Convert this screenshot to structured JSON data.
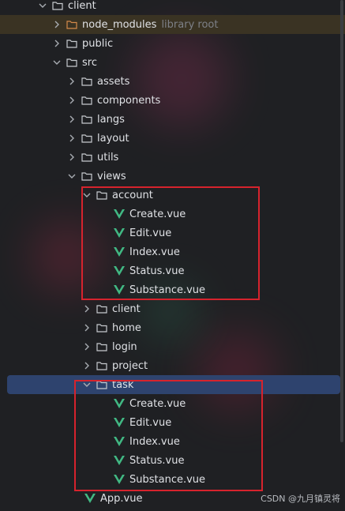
{
  "tree": {
    "root": "client",
    "node_modules": {
      "label": "node_modules",
      "hint": "library root"
    },
    "public": "public",
    "src": "src",
    "src_children": [
      "assets",
      "components",
      "langs",
      "layout",
      "utils"
    ],
    "views": "views",
    "account": {
      "label": "account",
      "files": [
        "Create.vue",
        "Edit.vue",
        "Index.vue",
        "Status.vue",
        "Substance.vue"
      ]
    },
    "views_children": [
      "client",
      "home",
      "login",
      "project"
    ],
    "task": {
      "label": "task",
      "files": [
        "Create.vue",
        "Edit.vue",
        "Index.vue",
        "Status.vue",
        "Substance.vue"
      ]
    },
    "app_file": "App.vue"
  },
  "watermark": "CSDN @九月镇灵将",
  "colors": {
    "background": "#1f2023",
    "selected_row": "#2e436e",
    "highlight": "#d6232d",
    "vue_green": "#41b883"
  },
  "icons": {
    "folder": "folder-icon",
    "vue": "vue-icon",
    "chevron_right": "chevron-right-icon",
    "chevron_down": "chevron-down-icon"
  }
}
